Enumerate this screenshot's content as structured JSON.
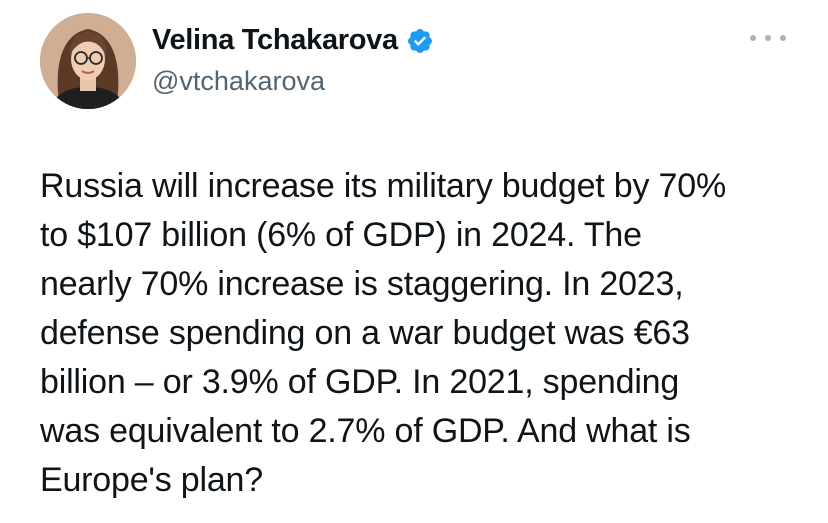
{
  "author": {
    "name": "Velina Tchakarova",
    "handle": "@vtchakarova",
    "verified": true
  },
  "icons": {
    "verified": "verified-badge-icon",
    "more": "more-options-icon"
  },
  "colors": {
    "verified_blue": "#1d9bf0",
    "text": "#0f1419",
    "secondary_text": "#536471"
  },
  "tweet": {
    "text": "Russia will increase its military budget by 70%\nto $107 billion (6% of GDP) in 2024. The\nnearly 70% increase is staggering. In 2023,\ndefense spending on a war budget was €63\nbillion – or 3.9% of GDP. In 2021, spending\nwas equivalent to 2.7% of GDP. And what is\nEurope's plan?"
  }
}
